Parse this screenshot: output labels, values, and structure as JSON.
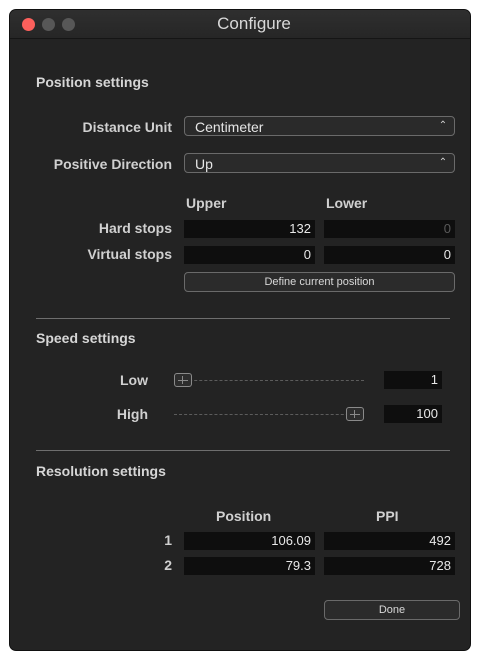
{
  "window": {
    "title": "Configure"
  },
  "position": {
    "title": "Position settings",
    "distance_unit_label": "Distance Unit",
    "distance_unit_value": "Centimeter",
    "positive_direction_label": "Positive Direction",
    "positive_direction_value": "Up",
    "upper_label": "Upper",
    "lower_label": "Lower",
    "hard_stops_label": "Hard stops",
    "hard_stops_upper": "132",
    "hard_stops_lower": "0",
    "virtual_stops_label": "Virtual stops",
    "virtual_stops_upper": "0",
    "virtual_stops_lower": "0",
    "define_button": "Define current position"
  },
  "speed": {
    "title": "Speed settings",
    "low_label": "Low",
    "low_value": "1",
    "low_level": 0,
    "high_label": "High",
    "high_value": "100",
    "high_level": 1
  },
  "resolution": {
    "title": "Resolution settings",
    "position_header": "Position",
    "ppi_header": "PPI",
    "rows": [
      {
        "index": "1",
        "position": "106.09",
        "ppi": "492"
      },
      {
        "index": "2",
        "position": "79.3",
        "ppi": "728"
      }
    ]
  },
  "footer": {
    "done_button": "Done"
  },
  "colors": {
    "close": "#fc605c",
    "window_bg": "#232323",
    "field_bg": "#0e0e0e"
  }
}
